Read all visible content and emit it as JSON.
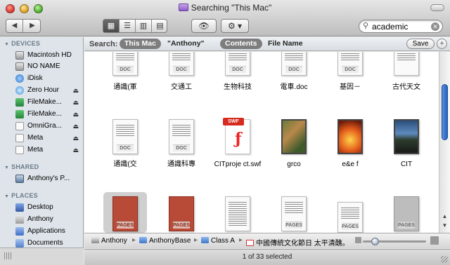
{
  "window": {
    "title": "Searching \"This Mac\""
  },
  "toolbar": {
    "back_label": "◀",
    "forward_label": "▶",
    "view_icons": [
      "▦",
      "☰",
      "▥",
      "▤"
    ],
    "quicklook_label": "👁",
    "action_label": "⚙ ▾",
    "search_value": "academic",
    "search_clear": "✕"
  },
  "sidebar": {
    "devices_header": "DEVICES",
    "devices": [
      {
        "label": "Macintosh HD",
        "icon": "hard-disk-icon",
        "eject": ""
      },
      {
        "label": "NO NAME",
        "icon": "disk-icon",
        "eject": ""
      },
      {
        "label": "iDisk",
        "icon": "idisk-icon",
        "eject": ""
      },
      {
        "label": "Zero Hour",
        "icon": "network-volume-icon",
        "eject": "⏏"
      },
      {
        "label": "FileMake...",
        "icon": "application-icon",
        "eject": "⏏"
      },
      {
        "label": "FileMake...",
        "icon": "application-icon",
        "eject": "⏏"
      },
      {
        "label": "OmniGra...",
        "icon": "disk-image-icon",
        "eject": "⏏"
      },
      {
        "label": "Meta",
        "icon": "document-icon",
        "eject": "⏏"
      },
      {
        "label": "Meta",
        "icon": "document-icon",
        "eject": "⏏"
      }
    ],
    "shared_header": "SHARED",
    "shared": [
      {
        "label": "Anthony's P...",
        "icon": "monitor-icon"
      }
    ],
    "places_header": "PLACES",
    "places": [
      {
        "label": "Desktop",
        "icon": "desktop-icon"
      },
      {
        "label": "Anthony",
        "icon": "home-icon"
      },
      {
        "label": "Applications",
        "icon": "applications-icon"
      },
      {
        "label": "Documents",
        "icon": "documents-icon"
      }
    ]
  },
  "searchbar": {
    "label": "Search:",
    "scope_this_mac": "This Mac",
    "scope_user": "\"Anthony\"",
    "field_contents": "Contents",
    "field_filename": "File Name",
    "save_label": "Save",
    "add_label": "+"
  },
  "files": [
    {
      "name": "通識(軍",
      "kind": "DOC"
    },
    {
      "name": "交通工",
      "kind": "DOC"
    },
    {
      "name": "生物科技",
      "kind": "DOC"
    },
    {
      "name": "電車.doc",
      "kind": "DOC"
    },
    {
      "name": "基因－",
      "kind": "DOC"
    },
    {
      "name": "古代天文",
      "kind": ""
    },
    {
      "name": "通識(交",
      "kind": "DOC"
    },
    {
      "name": "通識科專",
      "kind": "DOC"
    },
    {
      "name": "CITproje ct.swf",
      "kind": "SWF"
    },
    {
      "name": "grco",
      "kind": "image"
    },
    {
      "name": "e&e f",
      "kind": "image"
    },
    {
      "name": "CIT",
      "kind": "image"
    },
    {
      "name": "",
      "kind": "PAGES"
    },
    {
      "name": "",
      "kind": "PAGES"
    },
    {
      "name": "",
      "kind": ""
    },
    {
      "name": "",
      "kind": "PAGES"
    },
    {
      "name": "",
      "kind": "PAGES"
    },
    {
      "name": "",
      "kind": "PAGES"
    }
  ],
  "pathbar": {
    "crumbs": [
      "Anthony",
      "AnthonyBase",
      "Class A",
      "中國傳統文化節日 太平清醮。"
    ],
    "separator": "▸"
  },
  "status": {
    "text": "1 of 33 selected"
  },
  "colors": {
    "sidebar_bg": "#dee4ea",
    "scope_selected": "#7d7d7d",
    "scrollbar_thumb": "#2463c1"
  }
}
